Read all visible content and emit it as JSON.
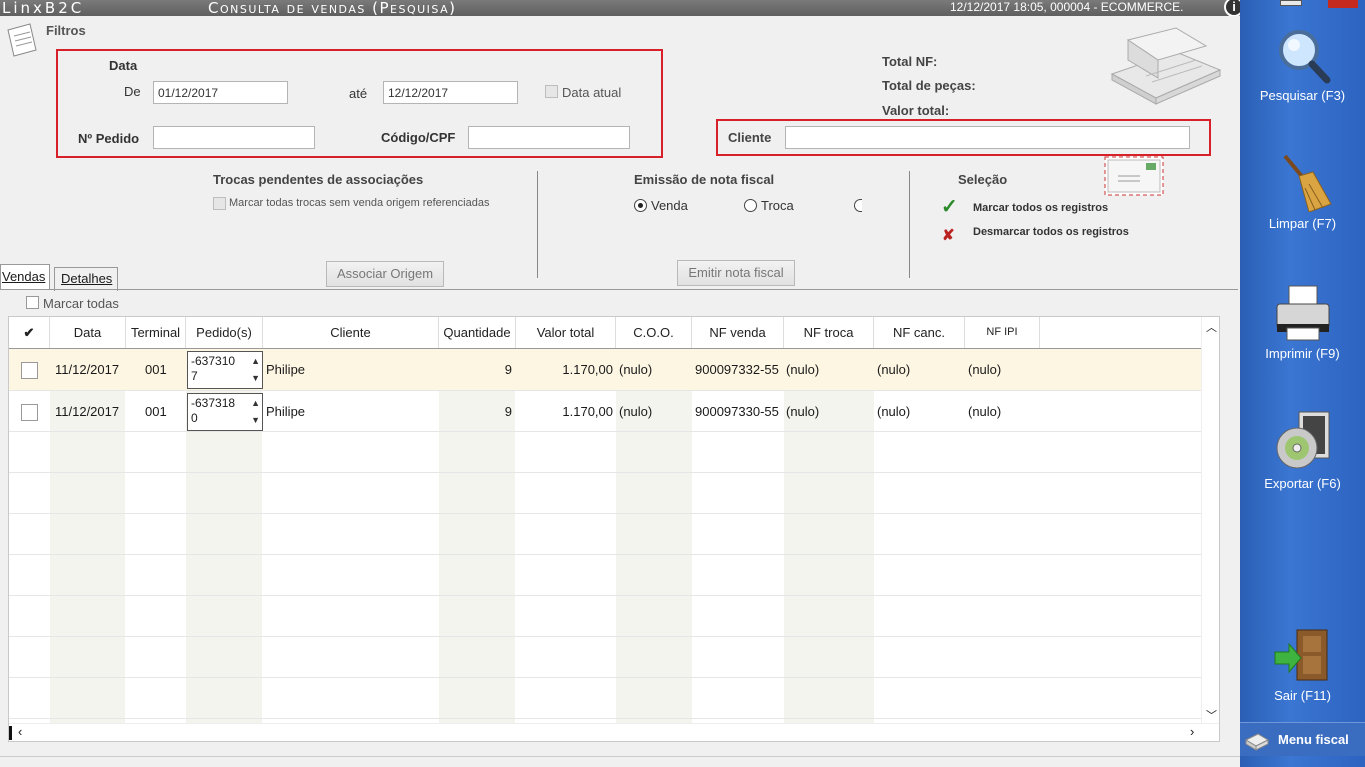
{
  "titlebar": {
    "app_name": "LinxB2C",
    "screen_title": "Consulta de vendas (Pesquisa)",
    "info": "12/12/2017 18:05, 000004 - ECOMMERCE.",
    "help": "i"
  },
  "filters": {
    "title": "Filtros",
    "data_label": "Data",
    "de_label": "De",
    "de_value": "01/12/2017",
    "ate_label": "até",
    "ate_value": "12/12/2017",
    "data_atual_label": "Data atual",
    "pedido_label": "Nº Pedido",
    "pedido_value": "",
    "codigo_label": "Código/CPF",
    "codigo_value": "",
    "cliente_label": "Cliente",
    "cliente_value": ""
  },
  "totals": {
    "total_nf": "Total NF:",
    "total_pecas": "Total de peças:",
    "valor_total": "Valor total:"
  },
  "trocas": {
    "title": "Trocas pendentes de associações",
    "checkbox_label": "Marcar todas trocas sem venda origem referenciadas",
    "button": "Associar Origem"
  },
  "emissao": {
    "title": "Emissão de nota fiscal",
    "opt_venda": "Venda",
    "opt_troca": "Troca",
    "button": "Emitir nota fiscal"
  },
  "selecao": {
    "title": "Seleção",
    "mark_all": "Marcar todos os registros",
    "unmark_all": "Desmarcar todos os registros"
  },
  "tabs": [
    {
      "label": "Vendas"
    },
    {
      "label": "Detalhes"
    }
  ],
  "marcar_todas": "Marcar todas",
  "grid": {
    "headers": {
      "check": "✔",
      "data": "Data",
      "terminal": "Terminal",
      "pedidos": "Pedido(s)",
      "cliente": "Cliente",
      "quantidade": "Quantidade",
      "valor_total": "Valor total",
      "coo": "C.O.O.",
      "nf_venda": "NF venda",
      "nf_troca": "NF troca",
      "nf_canc": "NF canc.",
      "nf_ipi": "NF IPI"
    },
    "rows": [
      {
        "data": "11/12/2017",
        "terminal": "001",
        "pedido_l1": "-637310",
        "pedido_l2": "7",
        "cliente": "Philipe",
        "quantidade": "9",
        "valor_total": "1.170,00",
        "coo": "(nulo)",
        "nf_venda": "900097332-55",
        "nf_troca": "(nulo)",
        "nf_canc": "(nulo)",
        "nf_ipi": "(nulo)"
      },
      {
        "data": "11/12/2017",
        "terminal": "001",
        "pedido_l1": "-637318",
        "pedido_l2": "0",
        "cliente": "Philipe",
        "quantidade": "9",
        "valor_total": "1.170,00",
        "coo": "(nulo)",
        "nf_venda": "900097330-55",
        "nf_troca": "(nulo)",
        "nf_canc": "(nulo)",
        "nf_ipi": "(nulo)"
      }
    ]
  },
  "sidebar": {
    "pesquisar": "Pesquisar (F3)",
    "limpar": "Limpar (F7)",
    "imprimir": "Imprimir (F9)",
    "exportar": "Exportar (F6)",
    "sair": "Sair (F11)",
    "menu_fiscal": "Menu fiscal"
  },
  "colors": {
    "highlight_box": "#d8202a",
    "sidebar_blue": "#3a76d2",
    "selected_row": "#fdf6e3"
  }
}
